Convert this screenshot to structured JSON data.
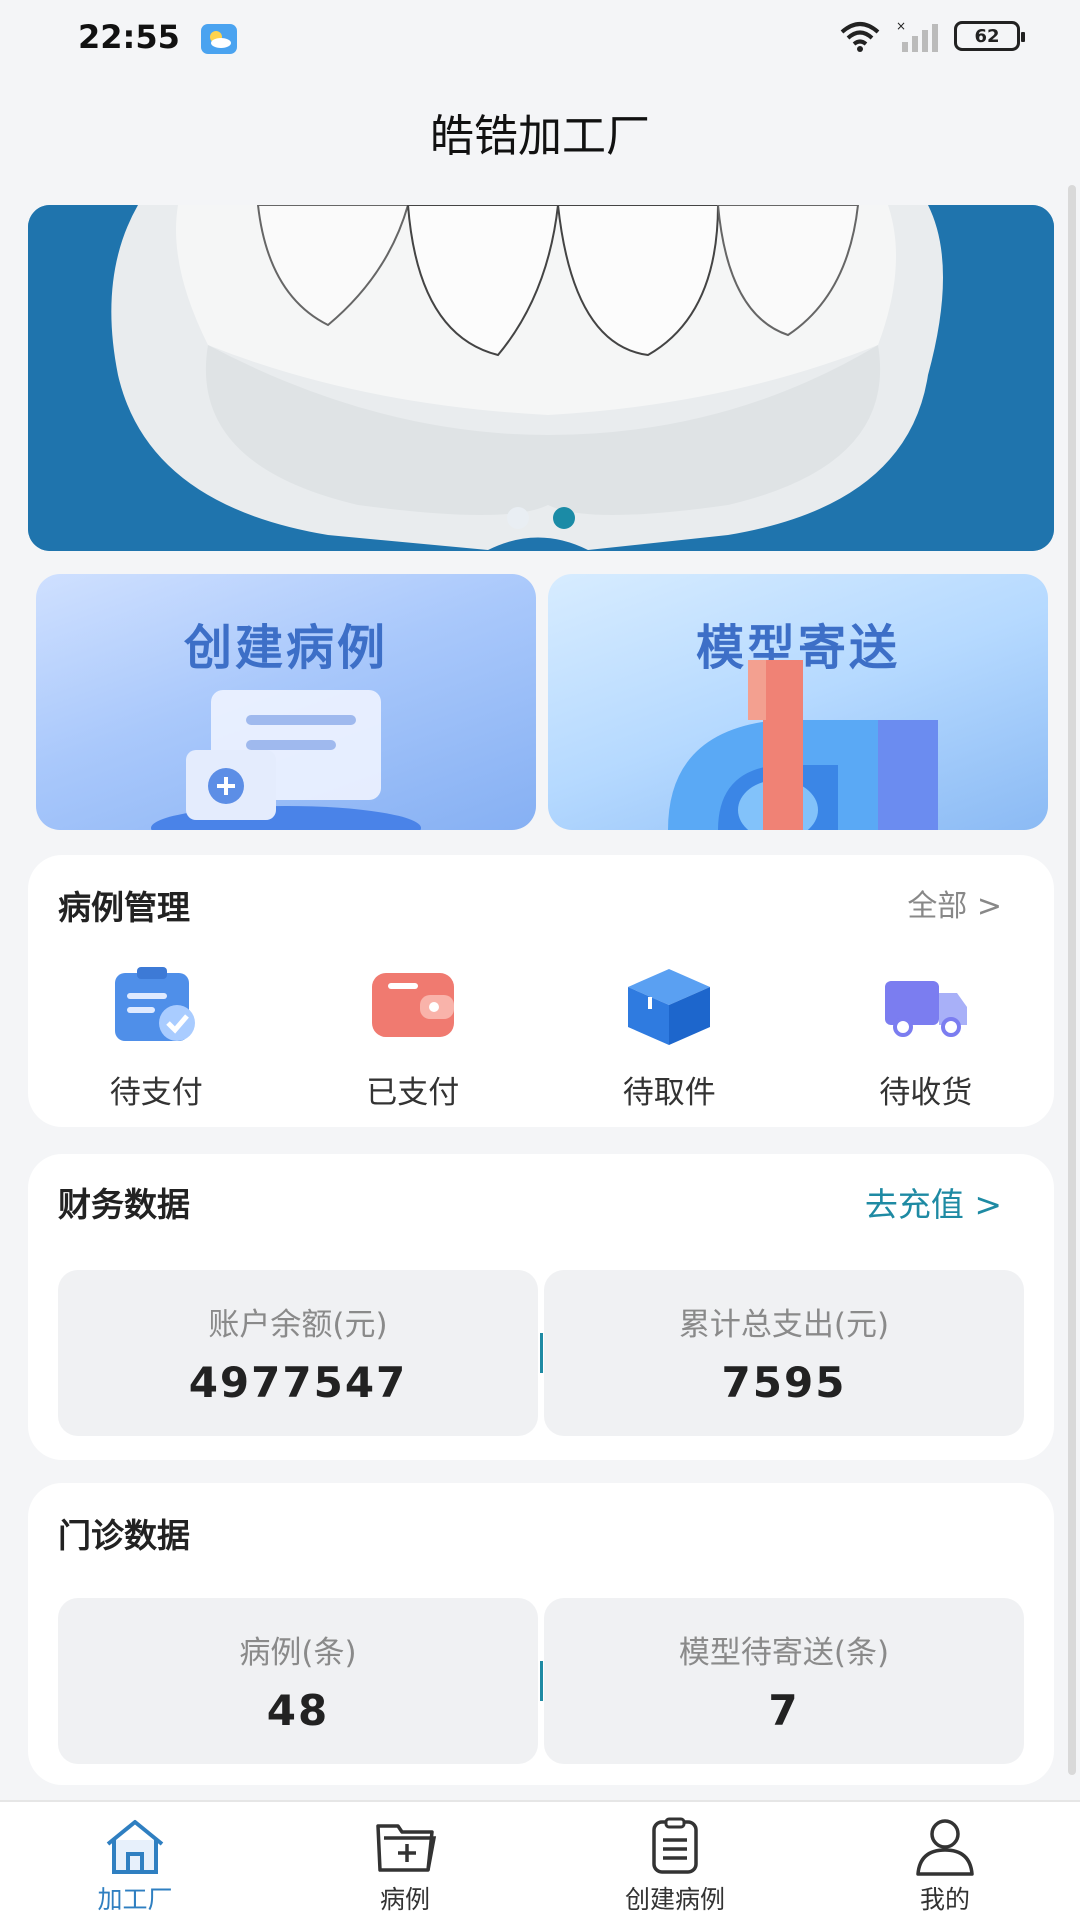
{
  "status_bar": {
    "time": "22:55",
    "battery": "62"
  },
  "header": {
    "title": "皓锆加工厂"
  },
  "banner": {
    "slide_count": 2,
    "active_index": 1
  },
  "quick_actions": [
    {
      "label": "创建病例",
      "icon": "create-case-illustration"
    },
    {
      "label": "模型寄送",
      "icon": "model-shipping-illustration"
    }
  ],
  "case_management": {
    "title": "病例管理",
    "link": "全部 >",
    "items": [
      {
        "label": "待支付",
        "icon": "pending-payment-icon"
      },
      {
        "label": "已支付",
        "icon": "wallet-icon"
      },
      {
        "label": "待取件",
        "icon": "box-icon"
      },
      {
        "label": "待收货",
        "icon": "truck-icon"
      }
    ]
  },
  "finance": {
    "title": "财务数据",
    "link": "去充值 >",
    "stats": [
      {
        "label": "账户余额(元)",
        "value": "4977547"
      },
      {
        "label": "累计总支出(元)",
        "value": "7595"
      }
    ]
  },
  "clinic": {
    "title": "门诊数据",
    "stats": [
      {
        "label": "病例(条)",
        "value": "48"
      },
      {
        "label": "模型待寄送(条)",
        "value": "7"
      }
    ]
  },
  "bottom_nav": [
    {
      "label": "加工厂",
      "icon": "home-icon",
      "active": true
    },
    {
      "label": "病例",
      "icon": "folder-plus-icon",
      "active": false
    },
    {
      "label": "创建病例",
      "icon": "document-icon",
      "active": false
    },
    {
      "label": "我的",
      "icon": "user-icon",
      "active": false
    }
  ],
  "colors": {
    "accent": "#2f7fc1",
    "teal": "#1e8aa3",
    "banner": "#1f74ad"
  }
}
